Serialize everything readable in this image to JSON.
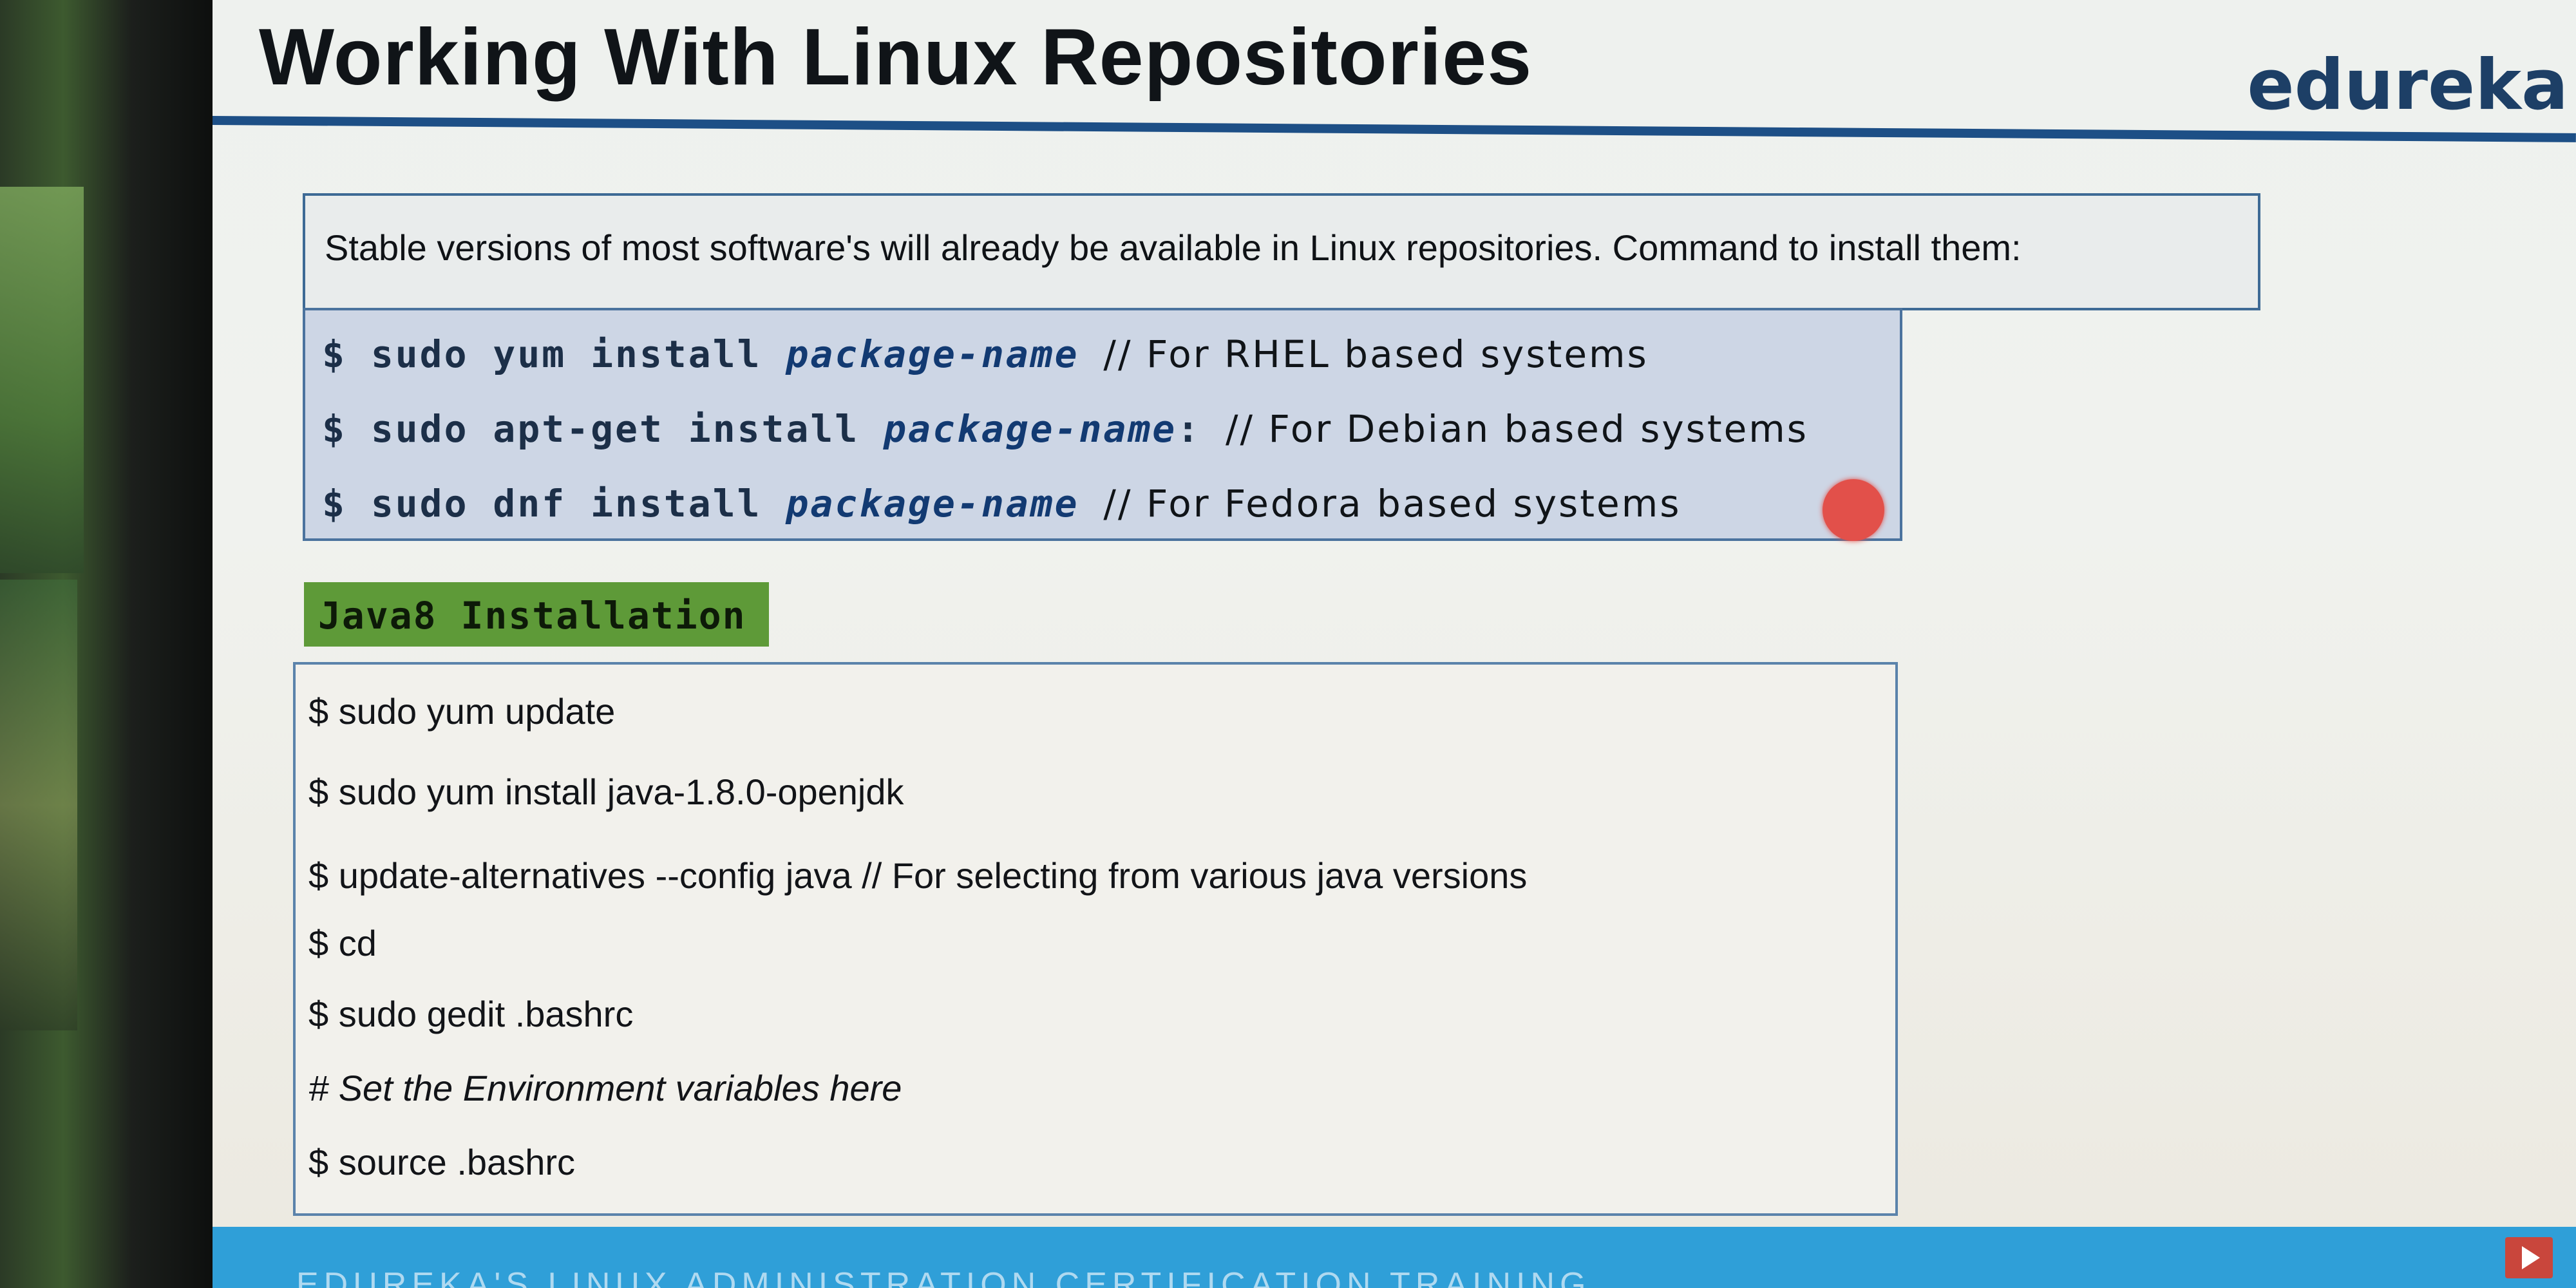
{
  "slide": {
    "title": "Working With Linux Repositories",
    "brand": "edureka",
    "intro": "Stable versions of most software's will already be available in Linux repositories. Command to install them:",
    "repo_commands": [
      {
        "prefix": "$ sudo yum install ",
        "pkg": "package-name",
        "sep": " ",
        "note": "// For RHEL based systems"
      },
      {
        "prefix": "$ sudo apt-get install ",
        "pkg": "package-name",
        "sep": ": ",
        "note": "// For Debian based systems"
      },
      {
        "prefix": "$ sudo dnf install ",
        "pkg": "package-name",
        "sep": " ",
        "note": "// For Fedora based systems"
      }
    ],
    "java_heading": "Java8 Installation",
    "java_lines": [
      "$ sudo yum update",
      "$ sudo yum install java-1.8.0-openjdk",
      "$ update-alternatives --config java   // For selecting from various java versions",
      "$ cd",
      "$ sudo gedit .bashrc",
      "# Set the Environment variables here",
      "$ source .bashrc"
    ],
    "footer": "EDUREKA'S LINUX ADMINISTRATION CERTIFICATION TRAINING"
  },
  "colors": {
    "title_rule": "#1d4f86",
    "brand": "#1d3f66",
    "repo_box_bg": "#cdd6e5",
    "java_tab_bg": "#5e9a38",
    "footer_bg": "#2f9fd8",
    "pointer": "#e2504a"
  },
  "icons": {
    "pointer": "laser-pointer-dot",
    "play": "play-icon"
  }
}
